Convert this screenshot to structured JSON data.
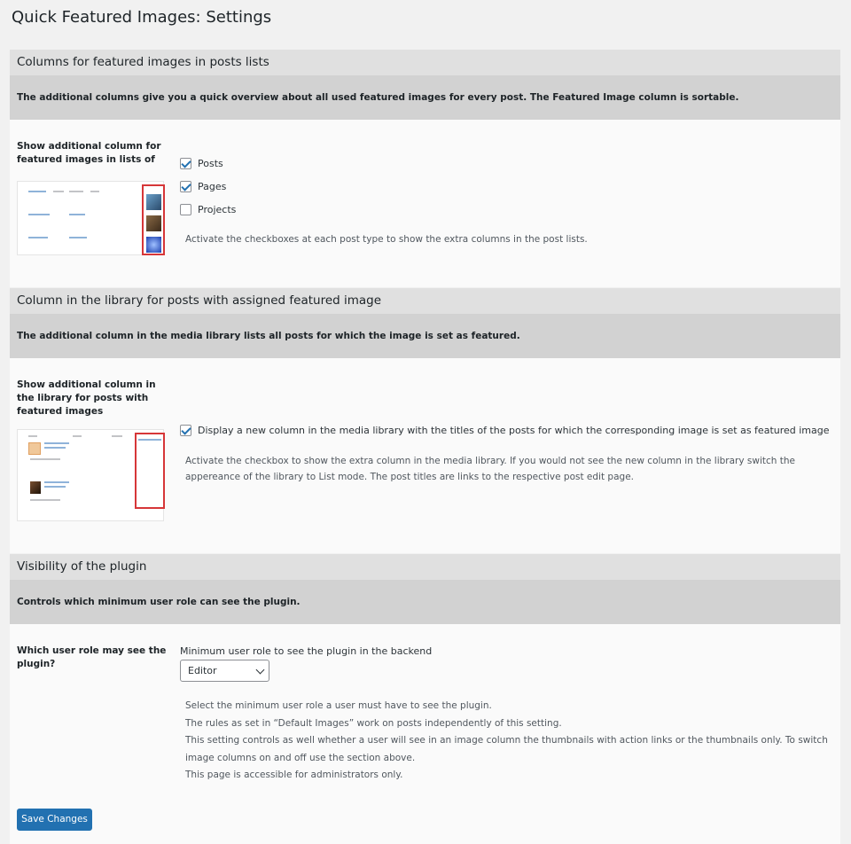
{
  "page": {
    "title": "Quick Featured Images: Settings"
  },
  "sections": {
    "columns": {
      "title": "Columns for featured images in posts lists",
      "description": "The additional columns give you a quick overview about all used featured images for every post. The Featured Image column is sortable.",
      "row_label": "Show additional column for featured images in lists of",
      "checkboxes": [
        {
          "label": "Posts",
          "checked": true
        },
        {
          "label": "Pages",
          "checked": true
        },
        {
          "label": "Projects",
          "checked": false
        }
      ],
      "help": "Activate the checkboxes at each post type to show the extra columns in the post lists."
    },
    "library": {
      "title": "Column in the library for posts with assigned featured image",
      "description": "The additional column in the media library lists all posts for which the image is set as featured.",
      "row_label": "Show additional column in the library for posts with featured images",
      "checkbox": {
        "label": "Display a new column in the media library with the titles of the posts for which the corresponding image is set as featured image",
        "checked": true
      },
      "help_1": "Activate the checkbox to show the extra column in the media library. If you would not see the new column in the library switch the",
      "help_2": "appereance of the library to List mode. The post titles are links to the respective post edit page."
    },
    "visibility": {
      "title": "Visibility of the plugin",
      "description": "Controls which minimum user role can see the plugin.",
      "row_label": "Which user role may see the plugin?",
      "select_label": "Minimum user role to see the plugin in the backend",
      "select_value": "Editor",
      "help_lines": [
        "Select the minimum user role a user must have to see the plugin.",
        "The rules as set in “Default Images” work on posts independently of this setting.",
        "This setting controls as well whether a user will see in an image column the thumbnails with action links or the thumbnails only. To switch",
        "image columns on and off use the section above.",
        "This page is accessible for administrators only."
      ]
    }
  },
  "actions": {
    "save_label": "Save Changes"
  },
  "colors": {
    "primary": "#2271b1",
    "highlight": "#d63638"
  }
}
